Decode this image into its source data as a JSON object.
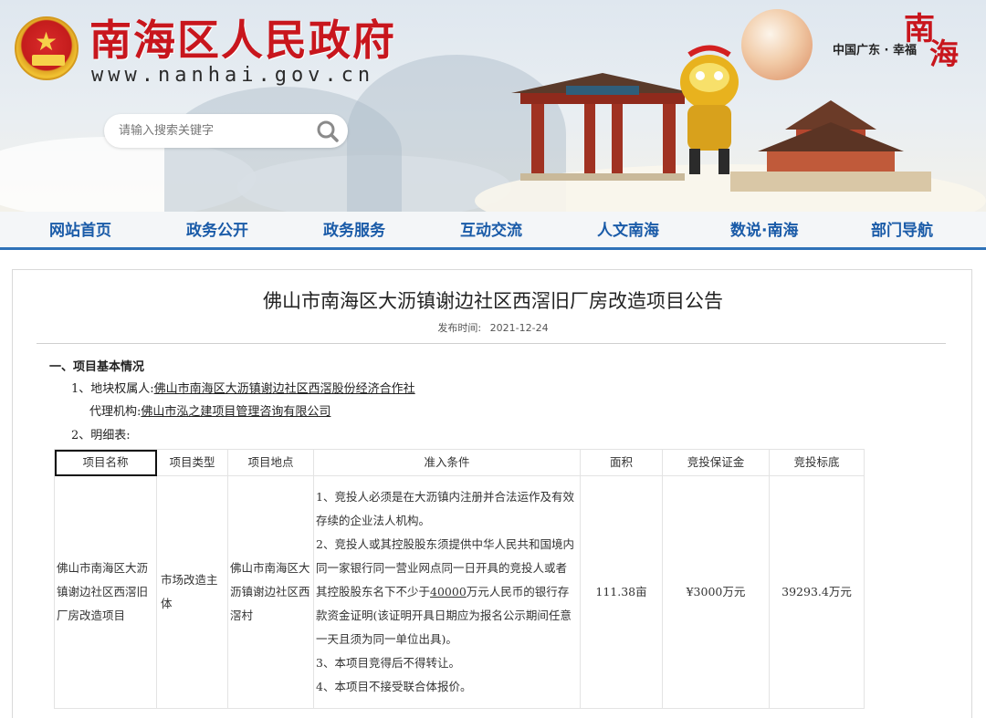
{
  "header": {
    "site_title": "南海区人民政府",
    "site_url": "www.nanhai.gov.cn",
    "search_placeholder": "请输入搜索关键字",
    "tagline": "中国广东 · 幸福",
    "tagline_char1": "南",
    "tagline_char2": "海",
    "icons": [
      "national-emblem-icon",
      "search-icon"
    ]
  },
  "nav": {
    "items": [
      {
        "label": "网站首页"
      },
      {
        "label": "政务公开"
      },
      {
        "label": "政务服务"
      },
      {
        "label": "互动交流"
      },
      {
        "label": "人文南海"
      },
      {
        "label": "数说·南海"
      },
      {
        "label": "部门导航"
      }
    ]
  },
  "article": {
    "title": "佛山市南海区大沥镇谢边社区西滘旧厂房改造项目公告",
    "pub_label": "发布时间:",
    "pub_date": "2021-12-24",
    "section1": "一、项目基本情况",
    "item1_label": "1、地块权属人:",
    "item1_value": "佛山市南海区大沥镇谢边社区西滘股份经济合作社",
    "agent_label": "代理机构:",
    "agent_value": "佛山市泓之建项目管理咨询有限公司",
    "item2_label": "2、明细表:"
  },
  "table": {
    "headers": [
      "项目名称",
      "项目类型",
      "项目地点",
      "准入条件",
      "面积",
      "竞投保证金",
      "竞投标底"
    ],
    "row": {
      "name": "佛山市南海区大沥镇谢边社区西滘旧厂房改造项目",
      "type": "市场改造主体",
      "location": "佛山市南海区大沥镇谢边社区西滘村",
      "cond1": "1、竞投人必须是在大沥镇内注册并合法运作及有效存续的企业法人机构。",
      "cond2_pre": "2、竞投人或其控股股东须提供中华人民共和国境内同一家银行同一营业网点同一日开具的竞投人或者其控股股东名下不少于",
      "cond2_amount": "40000",
      "cond2_post": "万元人民币的银行存款资金证明(该证明开具日期应为报名公示期间任意一天且须为同一单位出具)。",
      "cond3": "3、本项目竞得后不得转让。",
      "cond4": "4、本项目不接受联合体报价。",
      "area": "111.38亩",
      "deposit": "¥3000万元",
      "reserve": "39293.4万元"
    }
  },
  "colors": {
    "brand_red": "#c8161d",
    "nav_blue": "#1a5ba8",
    "nav_underline": "#2f72b8"
  }
}
